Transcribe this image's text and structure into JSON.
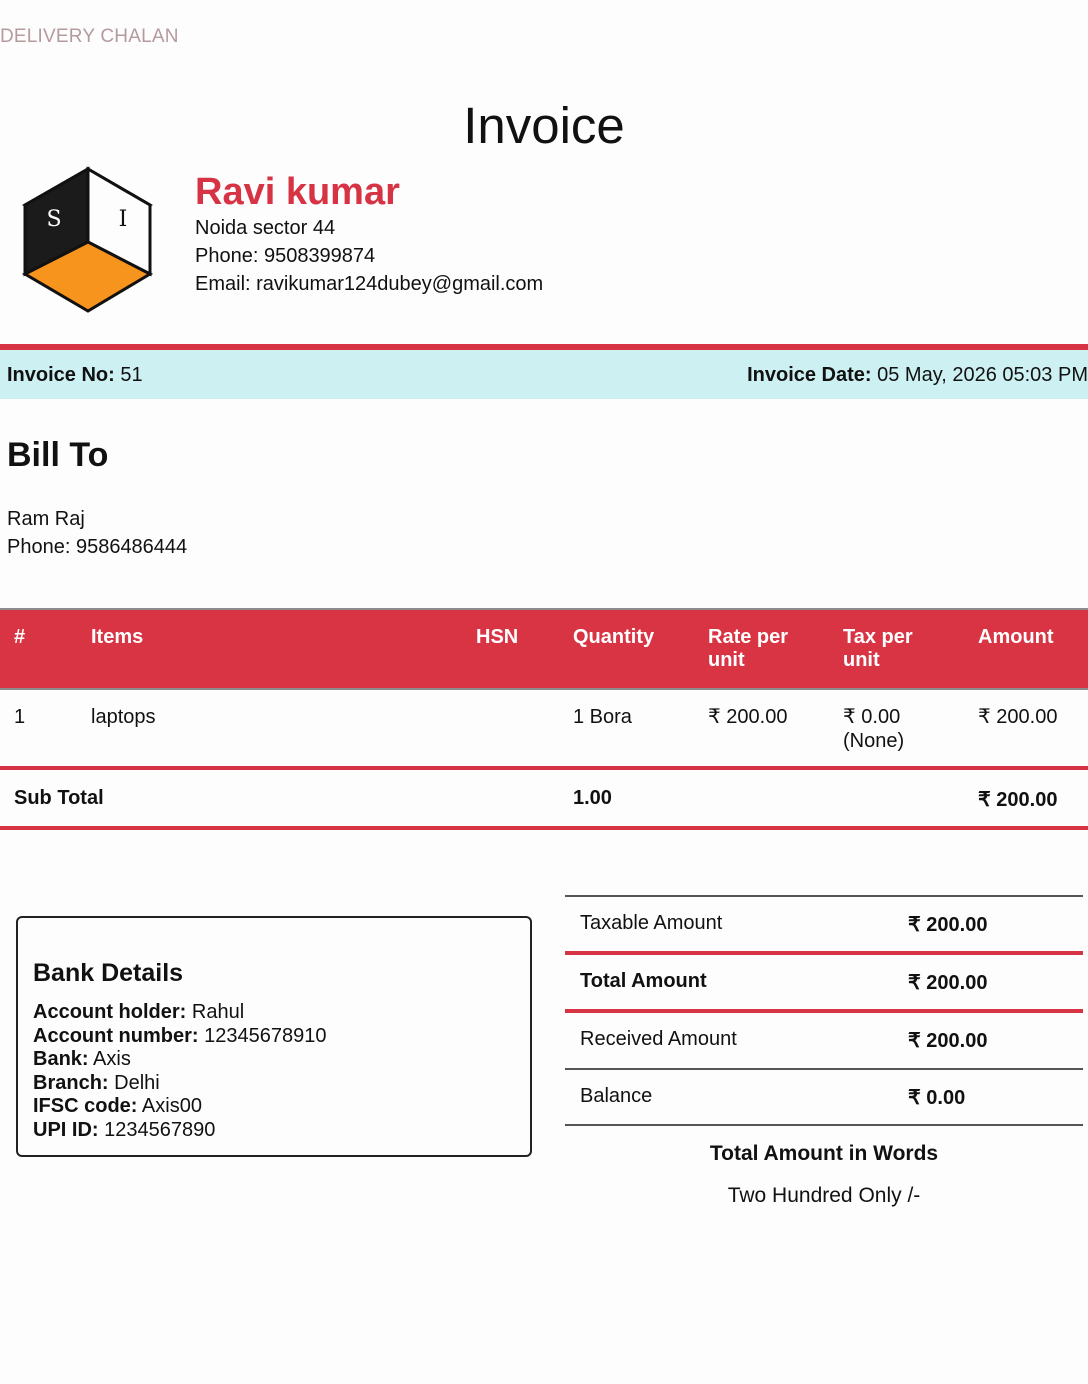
{
  "doc_type": "DELIVERY CHALAN",
  "title": "Invoice",
  "logo": {
    "letters": [
      "S",
      "I"
    ],
    "colors": {
      "top": "#1b1b1b",
      "bottom": "#f7941d"
    }
  },
  "company": {
    "name": "Ravi kumar",
    "address": "Noida sector 44",
    "phone": "Phone: 9508399874",
    "email": "Email: ravikumar124dubey@gmail.com"
  },
  "invoice": {
    "no_label": "Invoice No:",
    "no_value": " 51",
    "date_label": "Invoice Date:",
    "date_value": " 05 May, 2026 05:03 PM"
  },
  "bill_to": {
    "heading": "Bill To",
    "name": "Ram Raj",
    "phone": "Phone: 9586486444"
  },
  "table": {
    "columns": [
      "#",
      "Items",
      "HSN",
      "Quantity",
      "Rate per unit",
      "Tax per unit",
      "Amount"
    ],
    "rows": [
      {
        "num": "1",
        "item": "laptops",
        "hsn": "",
        "qty": "1 Bora",
        "rate": "₹ 200.00",
        "tax": "₹ 0.00",
        "tax_note": "(None)",
        "amount": "₹ 200.00"
      }
    ],
    "subtotal": {
      "label": "Sub Total",
      "qty": "1.00",
      "amount": "₹ 200.00"
    }
  },
  "bank": {
    "heading": "Bank Details",
    "holder_label": "Account holder:",
    "holder": " Rahul",
    "number_label": "Account number:",
    "number": " 12345678910",
    "bank_label": "Bank:",
    "bank": " Axis",
    "branch_label": "Branch:",
    "branch": " Delhi",
    "ifsc_label": "IFSC code:",
    "ifsc": " Axis00",
    "upi_label": "UPI ID:",
    "upi": " 1234567890"
  },
  "summary": {
    "taxable_label": "Taxable Amount",
    "taxable": "₹ 200.00",
    "total_label": "Total Amount",
    "total": "₹ 200.00",
    "received_label": "Received Amount",
    "received": "₹ 200.00",
    "balance_label": "Balance",
    "balance": "₹ 0.00",
    "words_label": "Total Amount in Words",
    "words": "Two Hundred Only /-"
  },
  "colors": {
    "accent": "#d63345",
    "info_bar": "#cdf1f3",
    "header_row": "#d93444"
  }
}
